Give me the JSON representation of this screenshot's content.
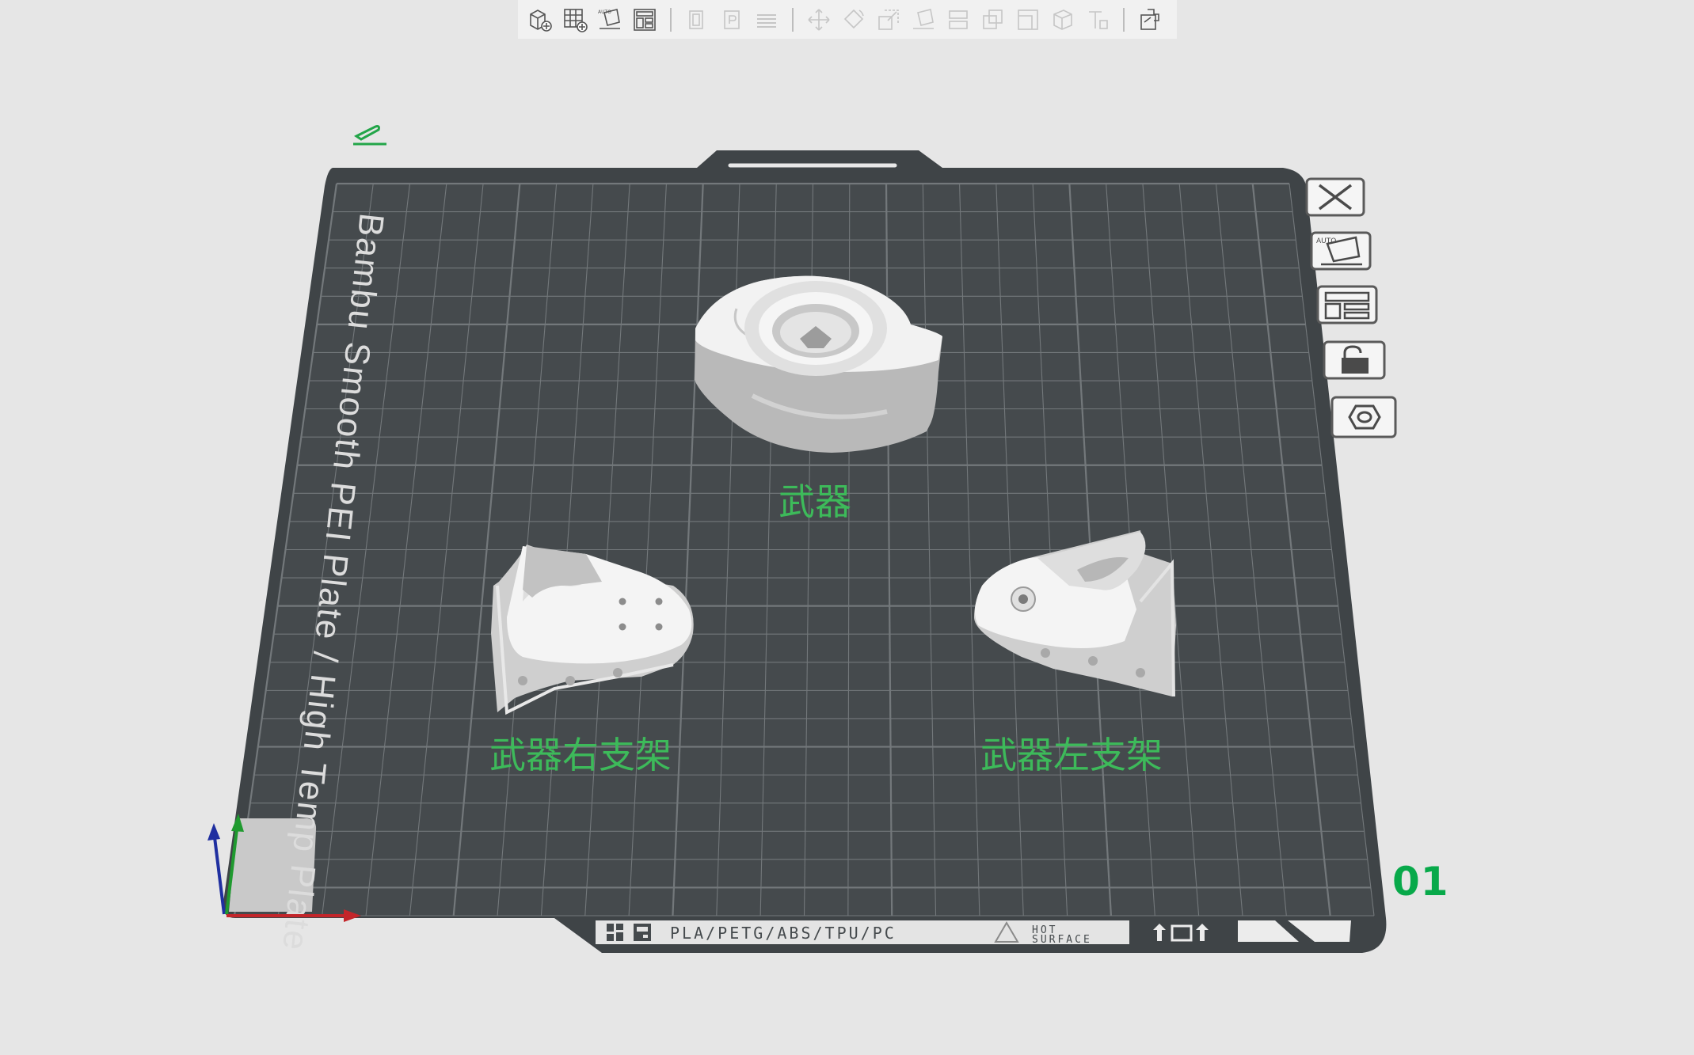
{
  "toolbar": {
    "groups": [
      [
        "add-object",
        "add-plate",
        "auto-orient",
        "arrange"
      ],
      [
        "copy",
        "paste",
        "layers"
      ],
      [
        "move",
        "rotate",
        "scale",
        "lay-on-face",
        "cut",
        "boolean",
        "split",
        "variable-layer",
        "text",
        "assembly-view"
      ]
    ]
  },
  "plate": {
    "name_text": "Bambu Smooth PEI Plate / High Temp Plate",
    "filaments_text": "PLA/PETG/ABS/TPU/PC",
    "hot_line1": "HOT",
    "hot_line2": "SURFACE",
    "number": "01",
    "colors": {
      "bed": "#454a4d",
      "grid": "#73787b",
      "accent": "#3dba5a"
    }
  },
  "objects": [
    {
      "label": "武器"
    },
    {
      "label": "武器右支架"
    },
    {
      "label": "武器左支架"
    }
  ],
  "plate_side_buttons": [
    "close-icon",
    "auto-orient-icon",
    "arrange-icon",
    "lock-icon",
    "plate-settings-icon"
  ]
}
